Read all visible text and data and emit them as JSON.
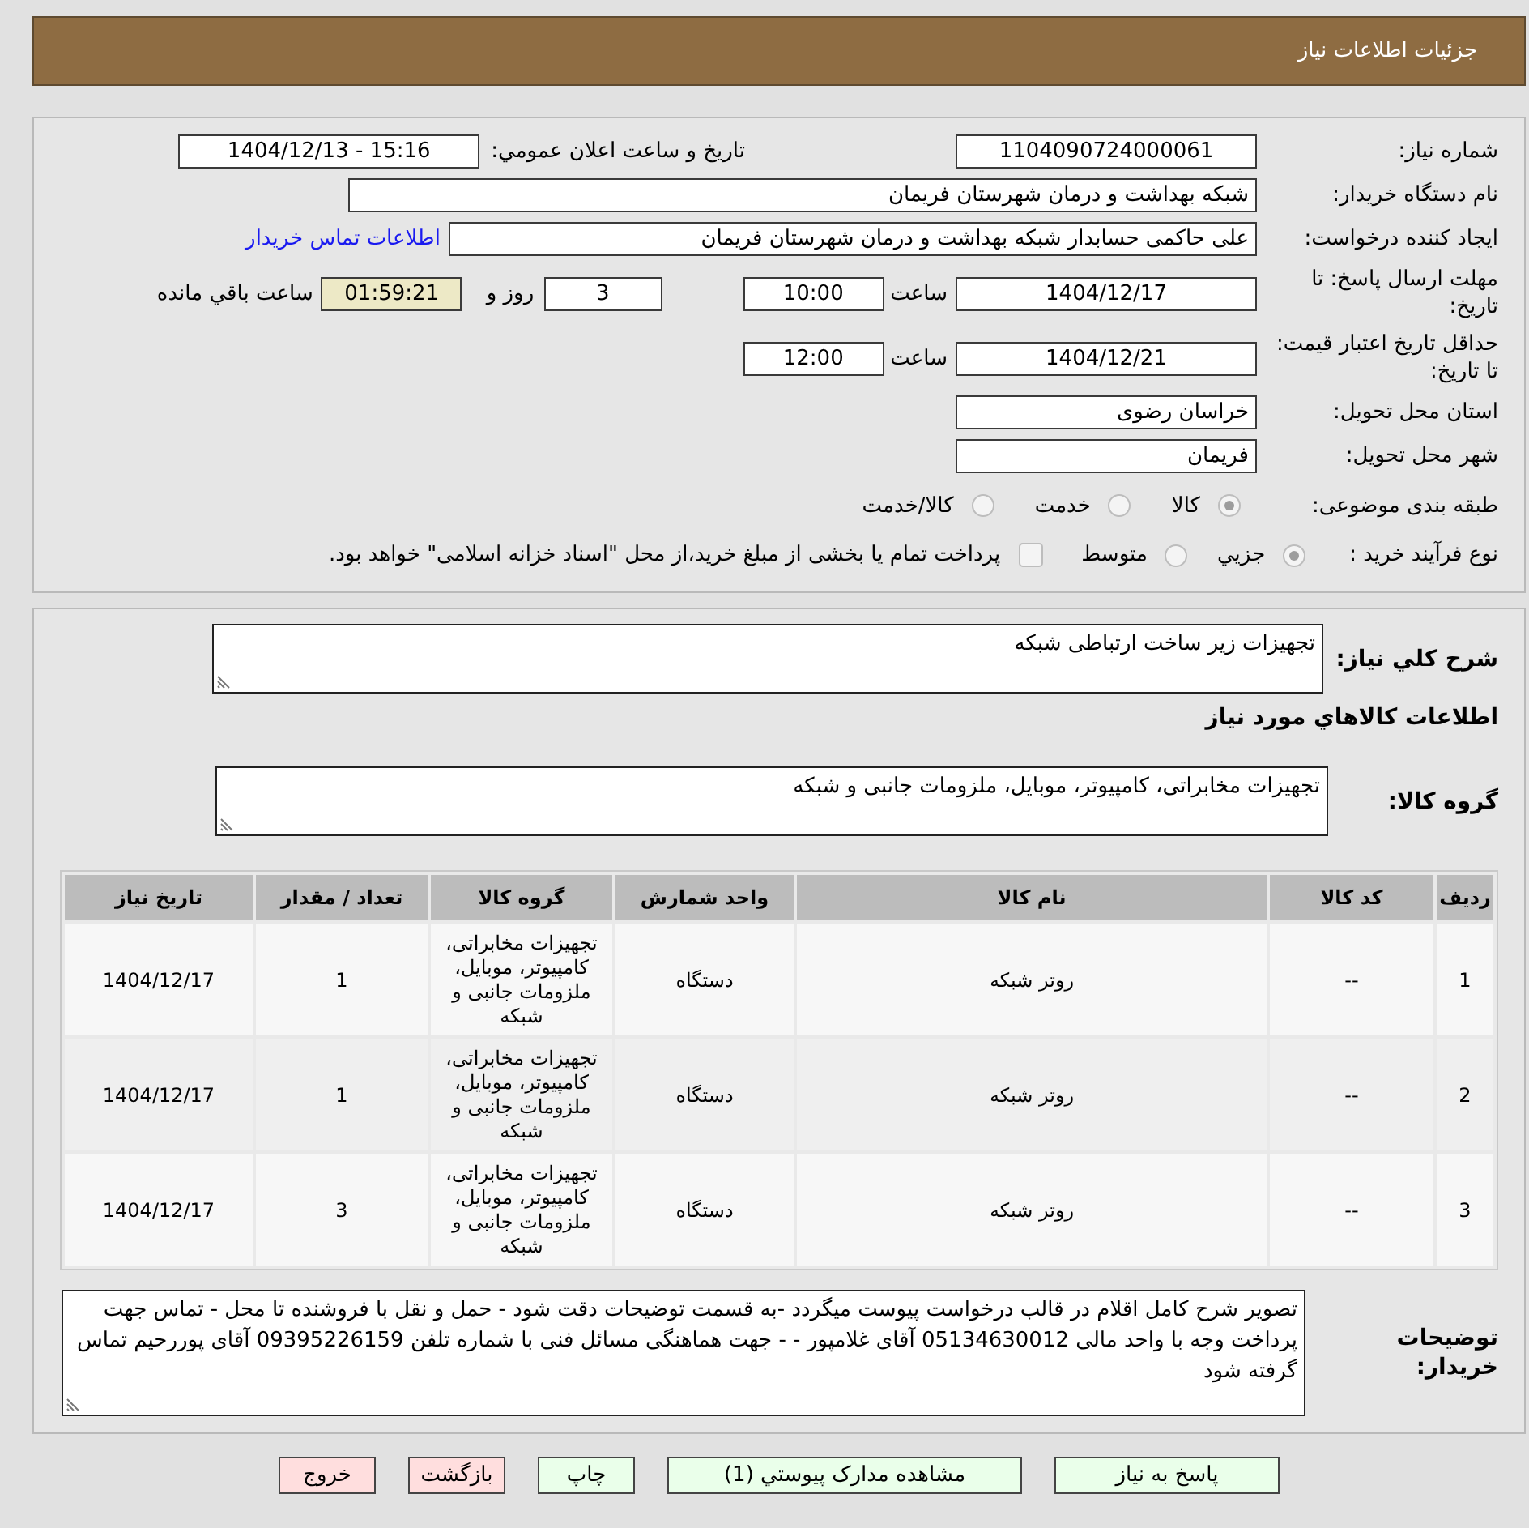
{
  "header": {
    "title": "جزئیات اطلاعات نیاز"
  },
  "details": {
    "need_number": {
      "label": "شماره نیاز:",
      "value": "1104090724000061"
    },
    "announce_datetime": {
      "label": "تاریخ و ساعت اعلان عمومي:",
      "value": "1404/12/13 - 15:16"
    },
    "buyer_org": {
      "label": "نام دستگاه خريدار:",
      "value": "شبکه بهداشت و درمان شهرستان فریمان"
    },
    "requester": {
      "label": "ایجاد کننده درخواست:",
      "value": "علی حاکمی حسابدار شبکه بهداشت و درمان شهرستان فریمان",
      "link": "اطلاعات تماس خريدار"
    },
    "reply_deadline": {
      "label": "مهلت ارسال پاسخ: تا تاریخ:",
      "date": "1404/12/17",
      "time_label": "ساعت",
      "time": "10:00",
      "days": "3",
      "days_label": "روز و",
      "remaining": "01:59:21",
      "remaining_label": "ساعت باقي مانده"
    },
    "price_validity": {
      "label": "حداقل تاریخ اعتبار قیمت: تا تاریخ:",
      "date": "1404/12/21",
      "time_label": "ساعت",
      "time": "12:00"
    },
    "delivery_province": {
      "label": "استان محل تحویل:",
      "value": "خراسان رضوی"
    },
    "delivery_city": {
      "label": "شهر محل تحویل:",
      "value": "فریمان"
    },
    "subject_category": {
      "label": "طبقه بندی موضوعی:",
      "options": [
        {
          "label": "کالا",
          "selected": true
        },
        {
          "label": "خدمت",
          "selected": false
        },
        {
          "label": "کالا/خدمت",
          "selected": false
        }
      ]
    },
    "purchase_process": {
      "label": "نوع فرآیند خرید :",
      "options": [
        {
          "label": "جزيي",
          "selected": true
        },
        {
          "label": "متوسط",
          "selected": false
        }
      ],
      "treasury_payment": {
        "checked": false,
        "label": "پرداخت تمام یا بخشی از مبلغ خرید،از محل \"اسناد خزانه اسلامی\" خواهد بود."
      }
    }
  },
  "need": {
    "summary": {
      "label": "شرح کلي نیاز:",
      "value": "تجهیزات زیر ساخت ارتباطی شبکه"
    },
    "goods_heading": "اطلاعات کالاهاي مورد نیاز",
    "goods_group": {
      "label": "گروه کالا:",
      "value": "تجهیزات مخابراتی، کامپیوتر، موبایل، ملزومات جانبی و شبکه"
    },
    "table": {
      "columns": [
        "ردیف",
        "کد کالا",
        "نام کالا",
        "واحد شمارش",
        "گروه کالا",
        "تعداد / مقدار",
        "تاریخ نیاز"
      ],
      "rows": [
        [
          "1",
          "--",
          "روتر شبکه",
          "دستگاه",
          "تجهیزات مخابراتی، کامپیوتر، موبایل، ملزومات جانبی و شبکه",
          "1",
          "1404/12/17"
        ],
        [
          "2",
          "--",
          "روتر شبکه",
          "دستگاه",
          "تجهیزات مخابراتی، کامپیوتر، موبایل، ملزومات جانبی و شبکه",
          "1",
          "1404/12/17"
        ],
        [
          "3",
          "--",
          "روتر شبکه",
          "دستگاه",
          "تجهیزات مخابراتی، کامپیوتر، موبایل، ملزومات جانبی و شبکه",
          "3",
          "1404/12/17"
        ]
      ]
    },
    "buyer_notes": {
      "label": "توضیحات خریدار:",
      "value": "تصویر شرح کامل اقلام در قالب درخواست پیوست میگردد -به قسمت توضیحات دقت شود - حمل و نقل با فروشنده تا محل - تماس جهت پرداخت وجه با واحد مالی 05134630012 آقای غلامپور  -  - جهت هماهنگی مسائل فنی با شماره تلفن 09395226159 آقای پوررحیم تماس گرفته شود"
    }
  },
  "buttons": [
    {
      "label": "پاسخ به نیاز",
      "color": "#eaffea"
    },
    {
      "label": "مشاهده مدارک پیوستي (1)",
      "color": "#eaffea"
    },
    {
      "label": "چاپ",
      "color": "#eaffea"
    },
    {
      "label": "بازگشت",
      "color": "#ffdede"
    },
    {
      "label": "خروج",
      "color": "#ffdede"
    }
  ]
}
